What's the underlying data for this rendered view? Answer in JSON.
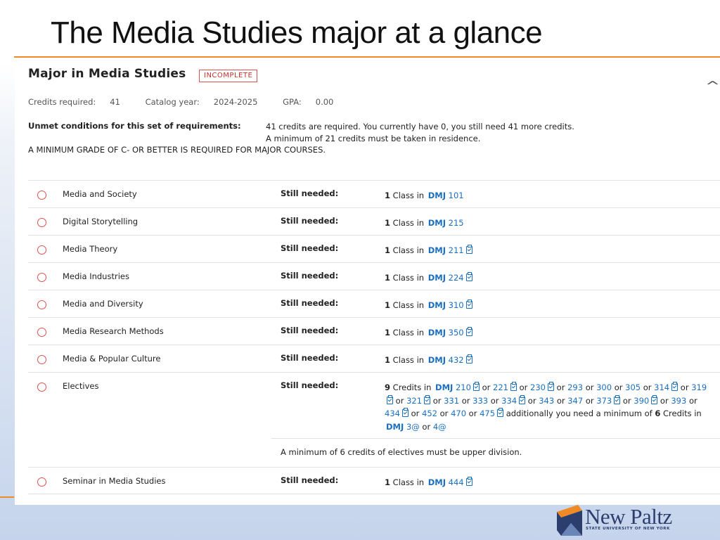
{
  "slide": {
    "title": "The Media Studies major at a glance"
  },
  "block": {
    "title": "Major in Media Studies",
    "status_badge": "INCOMPLETE",
    "credits_required_label": "Credits required:",
    "credits_required": "41",
    "catalog_year_label": "Catalog year:",
    "catalog_year": "2024-2025",
    "gpa_label": "GPA:",
    "gpa": "0.00",
    "unmet_label": "Unmet conditions for this set of requirements:",
    "unmet_lines": [
      "41 credits are required. You currently have 0, you still need 41 more credits.",
      "A minimum of 21 credits must be taken in residence."
    ],
    "grade_note": "A MINIMUM GRADE OF C- OR BETTER IS REQUIRED FOR MAJOR COURSES.",
    "still_needed_label": "Still needed:",
    "class_in_text": "Class in",
    "dept": "DMJ"
  },
  "requirements": [
    {
      "name": "Media and Society",
      "count": "1",
      "course": "101",
      "prereq_icon": false
    },
    {
      "name": "Digital Storytelling",
      "count": "1",
      "course": "215",
      "prereq_icon": false
    },
    {
      "name": "Media Theory",
      "count": "1",
      "course": "211",
      "prereq_icon": true
    },
    {
      "name": "Media Industries",
      "count": "1",
      "course": "224",
      "prereq_icon": true
    },
    {
      "name": "Media and Diversity",
      "count": "1",
      "course": "310",
      "prereq_icon": true
    },
    {
      "name": "Media Research Methods",
      "count": "1",
      "course": "350",
      "prereq_icon": true
    },
    {
      "name": "Media & Popular Culture",
      "count": "1",
      "course": "432",
      "prereq_icon": true
    }
  ],
  "electives": {
    "name": "Electives",
    "credits": "9",
    "credits_in_text": "Credits in",
    "or_text": "or",
    "courses": [
      {
        "num": "210",
        "icon": true
      },
      {
        "num": "221",
        "icon": true
      },
      {
        "num": "230",
        "icon": true
      },
      {
        "num": "293",
        "icon": false
      },
      {
        "num": "300",
        "icon": false
      },
      {
        "num": "305",
        "icon": false
      },
      {
        "num": "314",
        "icon": true
      },
      {
        "num": "319",
        "icon": true
      },
      {
        "num": "321",
        "icon": true
      },
      {
        "num": "331",
        "icon": false
      },
      {
        "num": "333",
        "icon": false
      },
      {
        "num": "334",
        "icon": true
      },
      {
        "num": "343",
        "icon": false
      },
      {
        "num": "347",
        "icon": false
      },
      {
        "num": "373",
        "icon": true
      },
      {
        "num": "390",
        "icon": true
      },
      {
        "num": "393",
        "icon": false
      },
      {
        "num": "434",
        "icon": true
      },
      {
        "num": "452",
        "icon": false
      },
      {
        "num": "470",
        "icon": false
      },
      {
        "num": "475",
        "icon": true
      }
    ],
    "additional_text": "additionally you need a minimum of",
    "additional_count": "6",
    "additional_courses": [
      "3@",
      "4@"
    ],
    "note": "A minimum of 6 credits of electives must be upper division."
  },
  "seminar": {
    "name": "Seminar in Media Studies",
    "count": "1",
    "course": "444",
    "prereq_icon": true
  },
  "logo": {
    "name": "New Paltz",
    "subtitle": "STATE UNIVERSITY OF NEW YORK"
  },
  "colors": {
    "accent_orange": "#f08a24",
    "link_blue": "#1a6fc0",
    "incomplete_red": "#d9534f",
    "logo_navy": "#2b3e6e"
  }
}
